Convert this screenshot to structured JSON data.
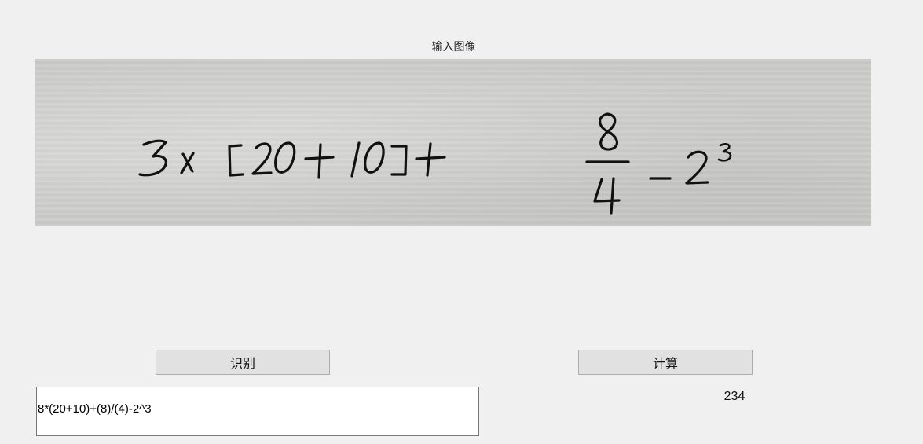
{
  "window": {
    "image_title": "输入图像"
  },
  "input_image": {
    "handwritten_expression": "3x[20+10]+ 8/4 -2^3"
  },
  "buttons": {
    "recognize_label": "识别",
    "calculate_label": "计算"
  },
  "expression_field": {
    "value": "8*(20+10)+(8)/(4)-2^3"
  },
  "result": {
    "value": "234"
  }
}
